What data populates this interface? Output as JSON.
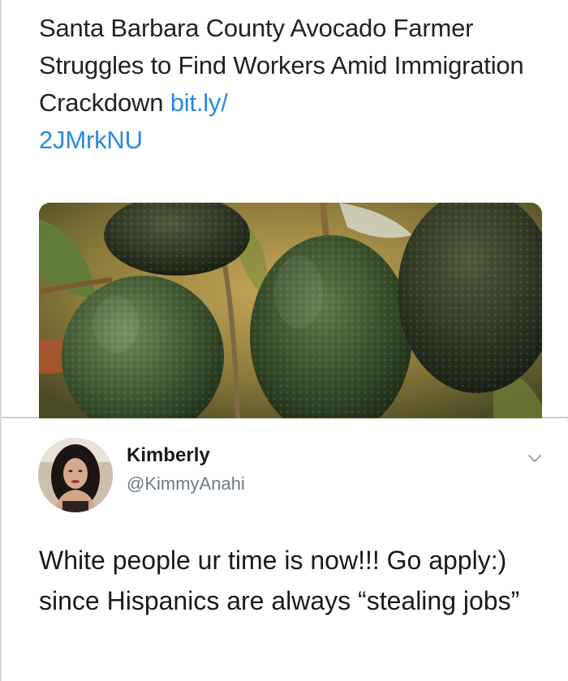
{
  "quoted_tweet": {
    "headline": "Santa Barbara County Avocado Farmer Struggles to Find Workers Amid Immigration Crackdown",
    "link_part1": "bit.ly/",
    "link_part2": "2JMrkNU",
    "media_icon": "avocado-photo"
  },
  "tweet": {
    "name": "Kimberly",
    "handle": "@KimmyAnahi",
    "text": "White people ur time is now!!! Go apply:) since Hispanics are always “stealing jobs”",
    "avatar_icon": "profile-photo",
    "menu_icon": "chevron-down-icon"
  },
  "colors": {
    "link": "#2a8ae0",
    "handle": "#6f7b84",
    "text": "#1a1a1a"
  }
}
